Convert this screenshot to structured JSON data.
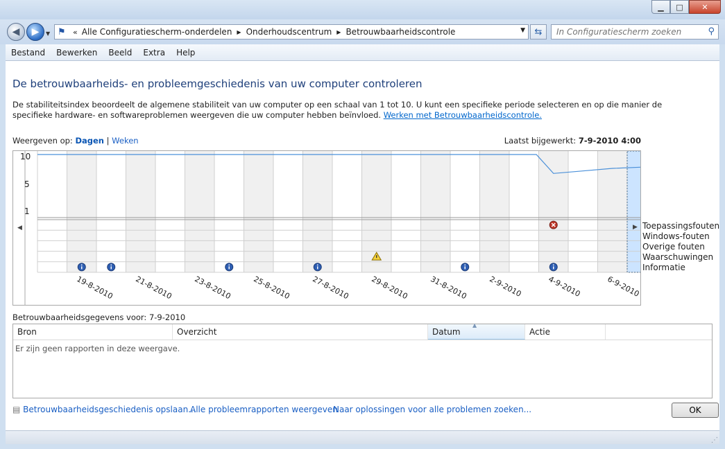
{
  "window": {
    "caption_buttons": [
      "minimize",
      "maximize",
      "close"
    ]
  },
  "nav": {
    "breadcrumbs": [
      "Alle Configuratiescherm-onderdelen",
      "Onderhoudscentrum",
      "Betrouwbaarheidscontrole"
    ],
    "search_placeholder": "In Configuratiescherm zoeken"
  },
  "menu": [
    "Bestand",
    "Bewerken",
    "Beeld",
    "Extra",
    "Help"
  ],
  "page": {
    "title": "De betrouwbaarheids- en probleemgeschiedenis van uw computer controleren",
    "description": "De stabiliteitsindex beoordeelt de algemene stabiliteit van uw computer op een schaal van 1 tot 10. U kunt een specifieke periode selecteren en op die manier de specifieke hardware- en softwareproblemen weergeven die uw computer hebben beïnvloed.",
    "description_link": "Werken met Betrouwbaarheidscontrole.",
    "view_label": "Weergeven op:",
    "view_days": "Dagen",
    "view_sep": "|",
    "view_weeks": "Weken",
    "updated_label": "Laatst bijgewerkt:",
    "updated_value": "7-9-2010 4:00"
  },
  "chart_data": {
    "type": "line",
    "y_ticks": [
      "10",
      "5",
      "1"
    ],
    "ylim": [
      0,
      10
    ],
    "x_labels": [
      "19-8-2010",
      "21-8-2010",
      "23-8-2010",
      "25-8-2010",
      "27-8-2010",
      "29-8-2010",
      "31-8-2010",
      "2-9-2010",
      "4-9-2010",
      "6-9-2010"
    ],
    "stability_index": [
      10,
      10,
      10,
      10,
      10,
      10,
      10,
      10,
      10,
      10,
      10,
      10,
      10,
      10,
      10,
      10,
      10,
      7,
      7.4,
      7.8,
      8
    ],
    "selected_column": 20,
    "categories": [
      "Toepassingsfouten",
      "Windows-fouten",
      "Overige fouten",
      "Waarschuwingen",
      "Informatie"
    ],
    "events": [
      {
        "day": 17,
        "category": 0,
        "icon": "error-icon"
      },
      {
        "day": 11,
        "category": 3,
        "icon": "warning-icon"
      },
      {
        "day": 1,
        "category": 4,
        "icon": "info-icon"
      },
      {
        "day": 2,
        "category": 4,
        "icon": "info-icon"
      },
      {
        "day": 6,
        "category": 4,
        "icon": "info-icon"
      },
      {
        "day": 9,
        "category": 4,
        "icon": "info-icon"
      },
      {
        "day": 14,
        "category": 4,
        "icon": "info-icon"
      },
      {
        "day": 17,
        "category": 4,
        "icon": "info-icon"
      }
    ]
  },
  "details": {
    "label": "Betrouwbaarheidsgegevens voor: 7-9-2010",
    "columns": [
      "Bron",
      "Overzicht",
      "Datum",
      "Actie"
    ],
    "empty_text": "Er zijn geen rapporten in deze weergave."
  },
  "footer": {
    "save_link": "Betrouwbaarheidsgeschiedenis opslaan...",
    "all_reports_link": "Alle probleemrapporten weergeven",
    "solutions_link": "Naar oplossingen voor alle problemen zoeken...",
    "ok": "OK"
  },
  "colors": {
    "line": "#4a90d9",
    "selected": "#cce4ff",
    "link": "#1a5fc4",
    "title": "#1e3f7a"
  }
}
